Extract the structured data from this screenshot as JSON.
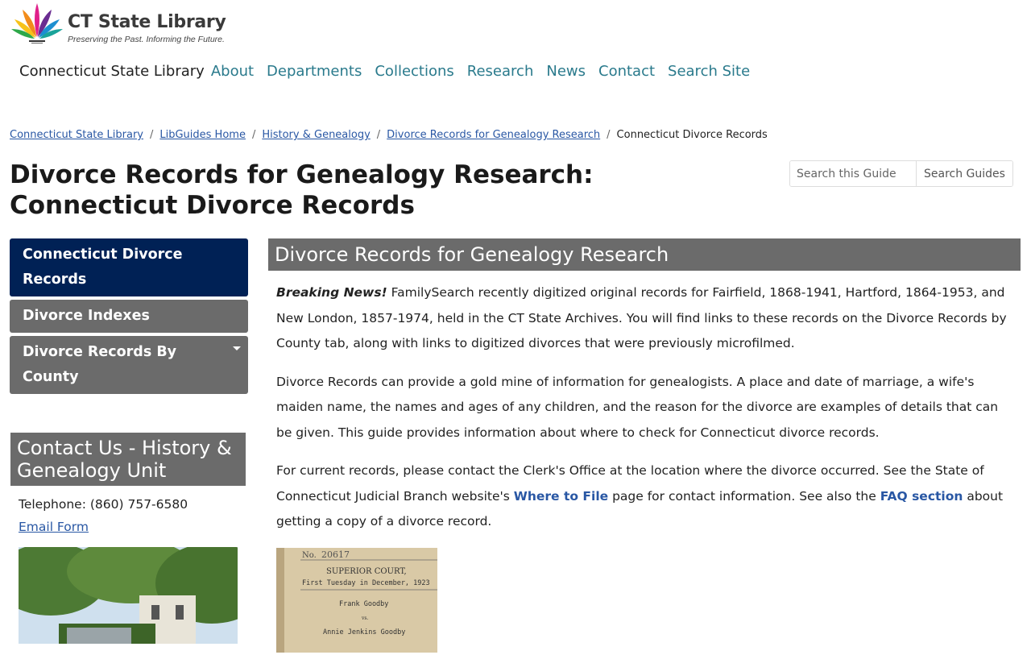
{
  "logo": {
    "title": "CT State Library",
    "tagline": "Preserving the Past. Informing the Future."
  },
  "nav": {
    "brand": "Connecticut State Library",
    "items": [
      {
        "label": "About"
      },
      {
        "label": "Departments"
      },
      {
        "label": "Collections"
      },
      {
        "label": "Research"
      },
      {
        "label": "News"
      },
      {
        "label": "Contact"
      },
      {
        "label": "Search Site"
      }
    ]
  },
  "breadcrumb": {
    "items": [
      "Connecticut State Library",
      "LibGuides Home",
      "History & Genealogy",
      "Divorce Records for Genealogy Research"
    ],
    "current": "Connecticut Divorce Records",
    "separator": "/"
  },
  "page": {
    "title_line1": "Divorce Records for Genealogy Research:",
    "title_line2": "Connecticut Divorce Records"
  },
  "search": {
    "placeholder": "Search this Guide",
    "button": "Search Guides"
  },
  "sidebar": {
    "items": [
      {
        "label": "Connecticut Divorce Records",
        "active": true
      },
      {
        "label": "Divorce Indexes",
        "active": false
      },
      {
        "label": "Divorce Records By County",
        "active": false
      }
    ]
  },
  "contact": {
    "heading": "Contact Us - History & Genealogy Unit",
    "telephone": "Telephone: (860) 757-6580",
    "email_link": "Email Form"
  },
  "main": {
    "heading": "Divorce Records for Genealogy Research",
    "p1_breaking": "Breaking News!",
    "p1_text": " FamilySearch recently digitized original records for Fairfield, 1868-1941, Hartford, 1864-1953, and New London, 1857-1974,  held in the CT State Archives. You will find links to these records on the Divorce Records by County tab, along with links to digitized divorces that were previously microfilmed.",
    "p2_text": "Divorce Records can provide a gold mine of information for genealogists. A place and date of marriage, a wife's maiden name, the names and ages of any children, and the reason for the divorce are examples of details that can be given. This guide provides information about where to check for Connecticut divorce records.",
    "p3_a": "For current records, please contact the Clerk's Office at the location where the divorce occurred. See the State of Connecticut Judicial Branch website's ",
    "p3_link1": "Where to File",
    "p3_b": " page for contact information. See also the ",
    "p3_link2": "FAQ section",
    "p3_c": " about getting a copy of a divorce record."
  },
  "document_image": {
    "no_label": "No.",
    "number": "20617",
    "court": "SUPERIOR COURT,",
    "term": "First Tuesday in December, 1923",
    "plaintiff": "Frank Goodby",
    "vs": "vs.",
    "defendant": "Annie Jenkins Goodby"
  },
  "colors": {
    "active_nav": "#002155",
    "inactive_nav": "#6b6b6b",
    "link": "#2957a4",
    "nav_link": "#2a7a8c"
  }
}
